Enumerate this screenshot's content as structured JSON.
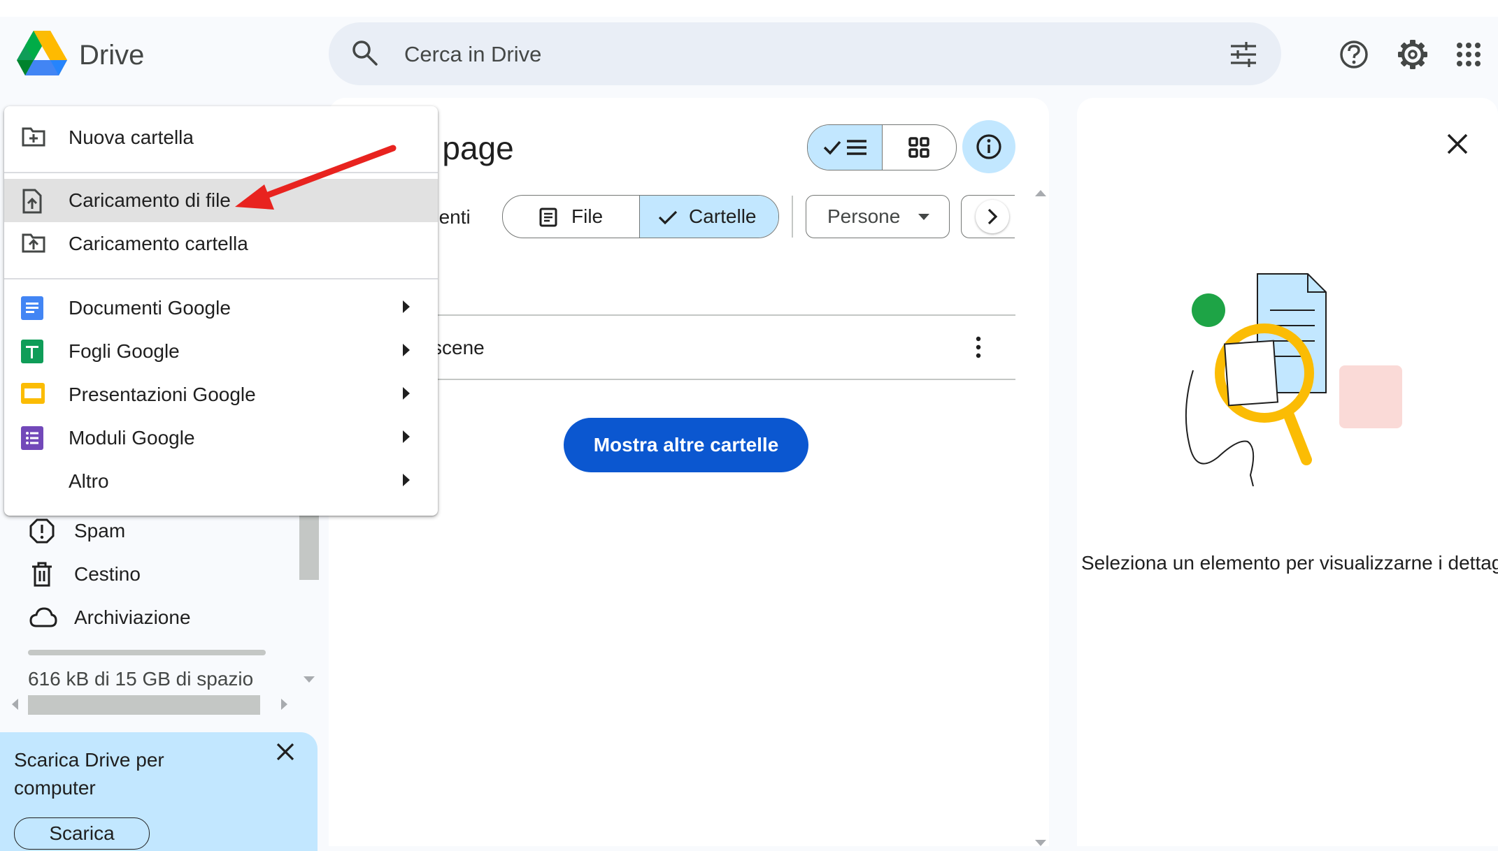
{
  "header": {
    "app_name": "Drive",
    "search_placeholder": "Cerca in Drive"
  },
  "main": {
    "title": "e page",
    "type_filter_label": "nenti",
    "chips": {
      "file": "File",
      "folders": "Cartelle",
      "people": "Persone"
    },
    "row": {
      "name": "scene"
    },
    "more_folders_button": "Mostra altre cartelle"
  },
  "details": {
    "empty_text": "Seleziona un elemento per visualizzarne i dettagl"
  },
  "sidebar": {
    "items": [
      {
        "label": "Spam",
        "icon": "spam-icon"
      },
      {
        "label": "Cestino",
        "icon": "trash-icon"
      },
      {
        "label": "Archiviazione",
        "icon": "cloud-icon"
      }
    ],
    "storage_text": "616 kB di 15 GB di spazio",
    "storage_used_fraction": 4e-05,
    "promo": {
      "text": "Scarica Drive per computer",
      "button": "Scarica"
    }
  },
  "new_menu": {
    "items": [
      {
        "label": "Nuova cartella",
        "icon": "new-folder-icon"
      },
      {
        "label": "Caricamento di file",
        "icon": "file-upload-icon",
        "highlighted": true
      },
      {
        "label": "Caricamento cartella",
        "icon": "folder-upload-icon"
      },
      {
        "label": "Documenti Google",
        "icon": "google-docs-icon",
        "submenu": true
      },
      {
        "label": "Fogli Google",
        "icon": "google-sheets-icon",
        "submenu": true
      },
      {
        "label": "Presentazioni Google",
        "icon": "google-slides-icon",
        "submenu": true
      },
      {
        "label": "Moduli Google",
        "icon": "google-forms-icon",
        "submenu": true
      },
      {
        "label": "Altro",
        "icon": "",
        "submenu": true
      }
    ]
  },
  "colors": {
    "accent": "#0b57d0",
    "selected_chip": "#c2e7ff",
    "annotation_arrow": "#e8231f"
  }
}
